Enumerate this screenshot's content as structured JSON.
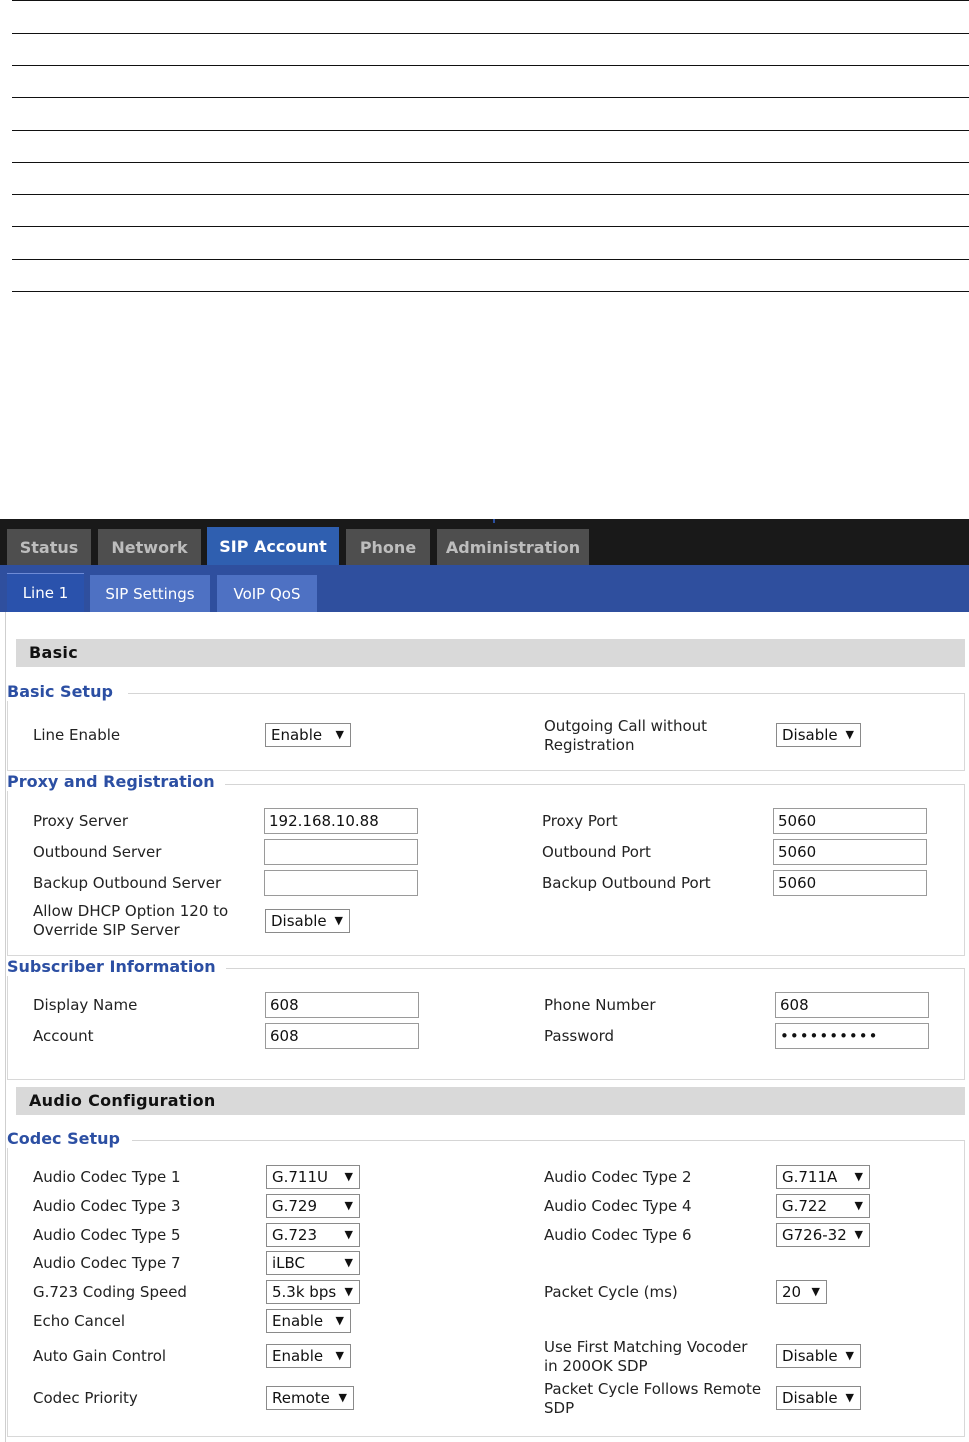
{
  "nav": {
    "top_tabs": [
      "Status",
      "Network",
      "SIP Account",
      "Phone",
      "Administration"
    ],
    "sub_tabs": [
      "Line 1",
      "SIP Settings",
      "VoIP QoS"
    ]
  },
  "basic": {
    "section_title": "Basic",
    "basic_setup": {
      "title": "Basic Setup",
      "line_enable_label": "Line Enable",
      "line_enable_value": "Enable",
      "outgoing_call_label": "Outgoing Call without Registration",
      "outgoing_call_value": "Disable"
    },
    "proxy": {
      "title": "Proxy and Registration",
      "proxy_server_label": "Proxy Server",
      "proxy_server_value": "192.168.10.88",
      "proxy_port_label": "Proxy Port",
      "proxy_port_value": "5060",
      "outbound_server_label": "Outbound Server",
      "outbound_server_value": "",
      "outbound_port_label": "Outbound Port",
      "outbound_port_value": "5060",
      "backup_server_label": "Backup Outbound Server",
      "backup_server_value": "",
      "backup_port_label": "Backup Outbound Port",
      "backup_port_value": "5060",
      "dhcp_label": "Allow DHCP Option 120 to Override SIP Server",
      "dhcp_value": "Disable"
    },
    "subscriber": {
      "title": "Subscriber Information",
      "display_name_label": "Display Name",
      "display_name_value": "608",
      "phone_number_label": "Phone Number",
      "phone_number_value": "608",
      "account_label": "Account",
      "account_value": "608",
      "password_label": "Password",
      "password_value": "••••••••••"
    }
  },
  "audio": {
    "section_title": "Audio Configuration",
    "codec_setup": {
      "title": "Codec Setup",
      "codec1_label": "Audio Codec Type 1",
      "codec1_value": "G.711U",
      "codec2_label": "Audio Codec Type 2",
      "codec2_value": "G.711A",
      "codec3_label": "Audio Codec Type 3",
      "codec3_value": "G.729",
      "codec4_label": "Audio Codec Type 4",
      "codec4_value": "G.722",
      "codec5_label": "Audio Codec Type 5",
      "codec5_value": "G.723",
      "codec6_label": "Audio Codec Type 6",
      "codec6_value": "G726-32",
      "codec7_label": "Audio Codec Type 7",
      "codec7_value": "iLBC",
      "g723_label": "G.723 Coding Speed",
      "g723_value": "5.3k bps",
      "packet_cycle_label": "Packet Cycle (ms)",
      "packet_cycle_value": "20",
      "echo_label": "Echo Cancel",
      "echo_value": "Enable",
      "agc_label": "Auto Gain Control",
      "agc_value": "Enable",
      "first_match_label": "Use First Matching Vocoder in 200OK SDP",
      "first_match_value": "Disable",
      "priority_label": "Codec Priority",
      "priority_value": "Remote",
      "follows_remote_label": "Packet Cycle Follows Remote SDP",
      "follows_remote_value": "Disable"
    }
  },
  "icons": {
    "dropdown": "dropdown-arrow-icon",
    "arrow_glyph": "▼"
  }
}
